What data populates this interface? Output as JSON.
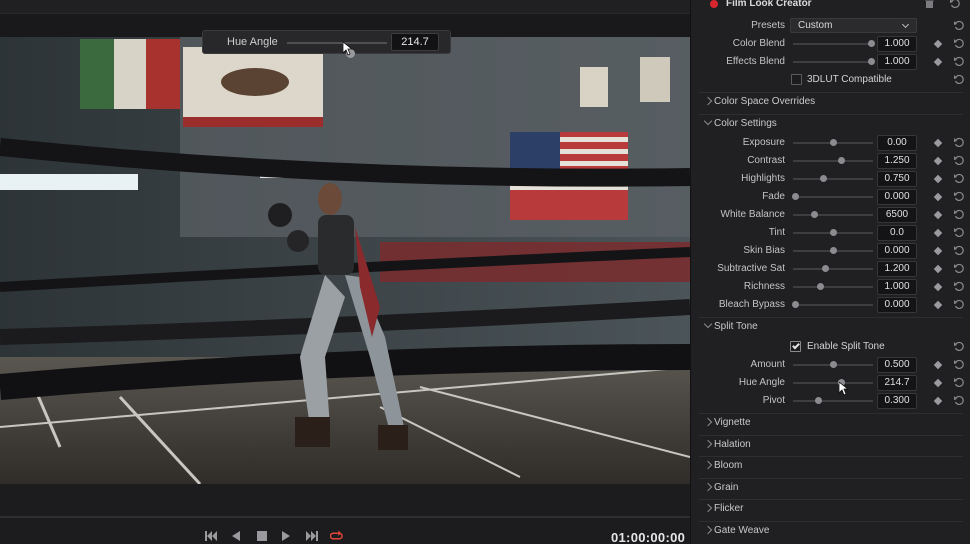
{
  "overlay": {
    "label": "Hue Angle",
    "value": "214.7",
    "slider_fraction": 0.61
  },
  "transport": {
    "timecode": "01:00:00:00",
    "buttons": [
      "skip-to-start-icon",
      "play-reverse-icon",
      "stop-icon",
      "play-icon",
      "skip-to-end-icon",
      "loop-icon"
    ],
    "loop_color": "#e0453a"
  },
  "inspector": {
    "title": "Film Look Creator",
    "enabled_color": "#d7262d",
    "presets": {
      "label": "Presets",
      "value": "Custom"
    },
    "top_params": [
      {
        "label": "Color Blend",
        "value": "1.000",
        "fraction": 1.0
      },
      {
        "label": "Effects Blend",
        "value": "1.000",
        "fraction": 1.0
      }
    ],
    "lut_checkbox": {
      "label": "3DLUT Compatible",
      "checked": false
    },
    "sections": {
      "color_space": "Color Space Overrides",
      "color_settings": "Color Settings",
      "split_tone": "Split Tone",
      "vignette": "Vignette",
      "halation": "Halation",
      "bloom": "Bloom",
      "grain": "Grain",
      "flicker": "Flicker",
      "gate_weave": "Gate Weave"
    },
    "color_settings": [
      {
        "label": "Exposure",
        "value": "0.00",
        "fraction": 0.5
      },
      {
        "label": "Contrast",
        "value": "1.250",
        "fraction": 0.6
      },
      {
        "label": "Highlights",
        "value": "0.750",
        "fraction": 0.37
      },
      {
        "label": "Fade",
        "value": "0.000",
        "fraction": 0.0
      },
      {
        "label": "White Balance",
        "value": "6500",
        "fraction": 0.25
      },
      {
        "label": "Tint",
        "value": "0.0",
        "fraction": 0.5
      },
      {
        "label": "Skin Bias",
        "value": "0.000",
        "fraction": 0.5
      },
      {
        "label": "Subtractive Sat",
        "value": "1.200",
        "fraction": 0.4
      },
      {
        "label": "Richness",
        "value": "1.000",
        "fraction": 0.33
      },
      {
        "label": "Bleach Bypass",
        "value": "0.000",
        "fraction": 0.0
      }
    ],
    "split_tone_checkbox": {
      "label": "Enable Split Tone",
      "checked": true
    },
    "split_tone": [
      {
        "label": "Amount",
        "value": "0.500",
        "fraction": 0.5
      },
      {
        "label": "Hue Angle",
        "value": "214.7",
        "fraction": 0.6
      },
      {
        "label": "Pivot",
        "value": "0.300",
        "fraction": 0.3
      }
    ]
  }
}
